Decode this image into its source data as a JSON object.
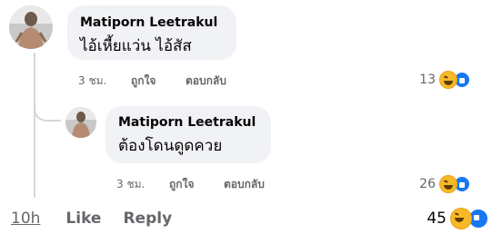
{
  "comment": {
    "author": "Matiporn Leetrakul",
    "text": "ไอ้เหี้ยแว่น ไอ้สัส",
    "time": "3 ชม.",
    "like_label": "ถูกใจ",
    "reply_label": "ตอบกลับ",
    "reaction_count": "13"
  },
  "reply": {
    "author": "Matiporn Leetrakul",
    "text": "ต้องโดนดูดควย",
    "time": "3 ชม.",
    "like_label": "ถูกใจ",
    "reply_label": "ตอบกลับ",
    "reaction_count": "26"
  },
  "post_footer": {
    "time": "10h",
    "like_label": "Like",
    "reply_label": "Reply",
    "reaction_count": "45"
  },
  "icons": {
    "reaction_1": "haha-emoji-icon",
    "reaction_2": "thumbs-up-icon"
  },
  "colors": {
    "bubble": "#f0f2f5",
    "meta_text": "#65676b",
    "like_blue": "#1877f2",
    "haha_yellow": "#f7b928"
  }
}
